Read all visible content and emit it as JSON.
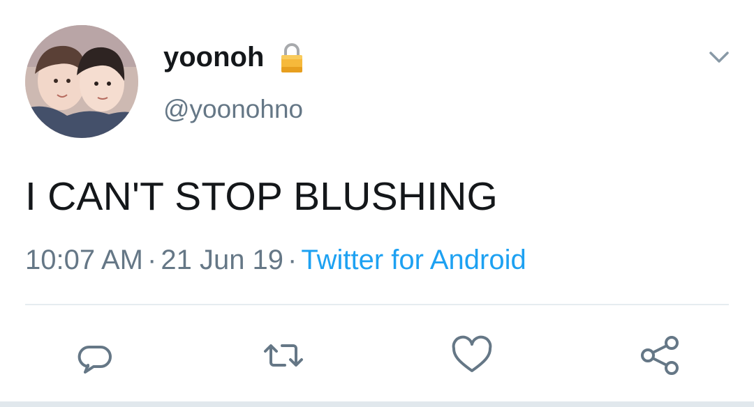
{
  "user": {
    "display_name": "yoonoh",
    "handle": "@yoonohno",
    "protected_icon": "lock-icon",
    "avatar": "profile-photo"
  },
  "tweet": {
    "text": "I CAN'T STOP BLUSHING",
    "time": "10:07 AM",
    "separator": "·",
    "date": "21 Jun 19",
    "source": "Twitter for Android"
  },
  "actions": {
    "reply_icon": "reply-icon",
    "retweet_icon": "retweet-icon",
    "like_icon": "heart-icon",
    "share_icon": "share-icon"
  },
  "colors": {
    "text": "#14171a",
    "secondary": "#657786",
    "link": "#1da1f2",
    "divider": "#e6ecf0"
  }
}
